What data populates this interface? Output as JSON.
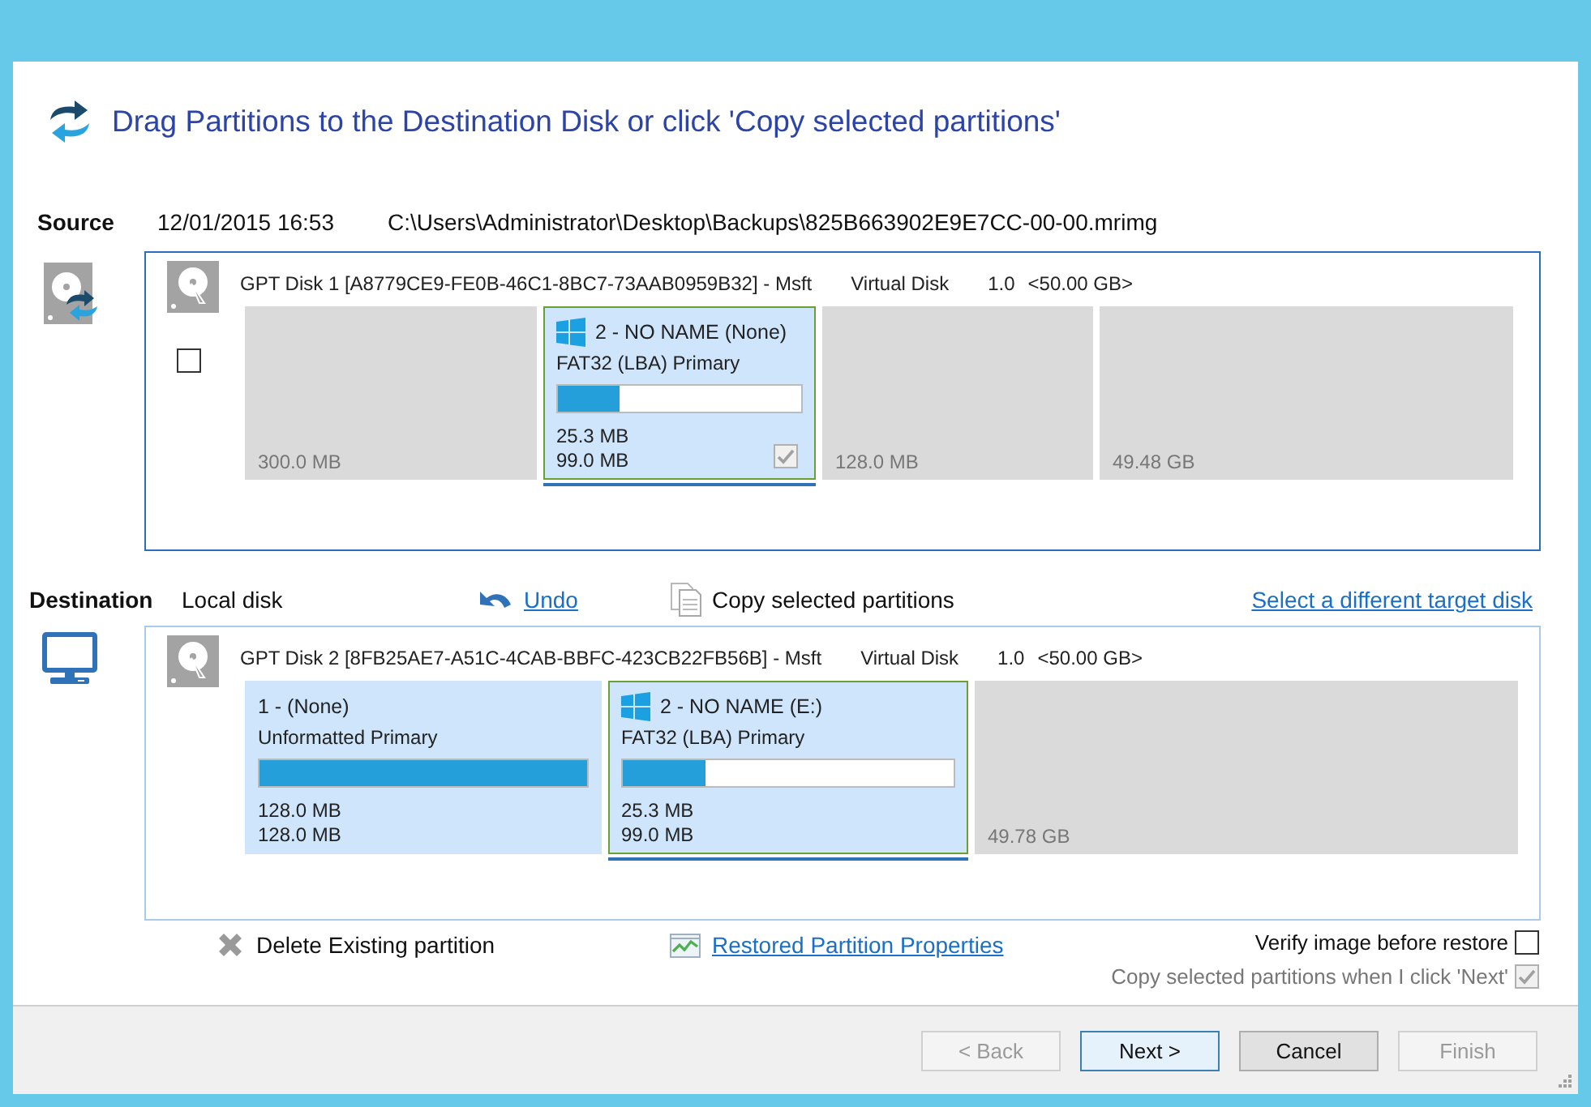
{
  "header": {
    "title": "Drag Partitions to the Destination Disk or click 'Copy selected partitions'"
  },
  "source": {
    "label": "Source",
    "date": "12/01/2015 16:53",
    "path": "C:\\Users\\Administrator\\Desktop\\Backups\\825B663902E9E7CC-00-00.mrimg",
    "disk": {
      "checked": false,
      "name": "GPT Disk 1 [A8779CE9-FE0B-46C1-8BC7-73AAB0959B32] - Msft",
      "type": "Virtual Disk",
      "version": "1.0",
      "size": "<50.00 GB>",
      "partitions": [
        {
          "kind": "empty",
          "total": "300.0 MB"
        },
        {
          "kind": "volume",
          "logo": true,
          "selected": true,
          "checked": true,
          "title": "2 - NO NAME (None)",
          "filesystem": "FAT32 (LBA) Primary",
          "level": 0.25,
          "used": "25.3 MB",
          "total": "99.0 MB"
        },
        {
          "kind": "empty",
          "total": "128.0 MB"
        },
        {
          "kind": "empty",
          "total": "49.48 GB"
        }
      ]
    }
  },
  "destination": {
    "label": "Destination",
    "target": "Local disk",
    "undo": "Undo",
    "copy": "Copy selected partitions",
    "select_link": "Select a different target disk",
    "disk": {
      "name": "GPT Disk 2 [8FB25AE7-A51C-4CAB-BBFC-423CB22FB56B] - Msft",
      "type": "Virtual Disk",
      "version": "1.0",
      "size": "<50.00 GB>",
      "partitions": [
        {
          "kind": "volume",
          "logo": false,
          "selected": false,
          "title": "1 -  (None)",
          "filesystem": "Unformatted Primary",
          "level": 1,
          "used": "128.0 MB",
          "total": "128.0 MB"
        },
        {
          "kind": "volume",
          "logo": true,
          "selected": true,
          "title": "2 - NO NAME (E:)",
          "filesystem": "FAT32 (LBA) Primary",
          "level": 0.25,
          "used": "25.3 MB",
          "total": "99.0 MB"
        },
        {
          "kind": "empty",
          "total": "49.78 GB"
        }
      ]
    }
  },
  "actions": {
    "delete": "Delete Existing partition",
    "properties": "Restored Partition Properties"
  },
  "options": [
    {
      "label": "Verify image before restore",
      "checked": false,
      "disabled": false
    },
    {
      "label": "Copy selected partitions when I click 'Next'",
      "checked": true,
      "disabled": true
    }
  ],
  "buttons": [
    {
      "label": "< Back",
      "disabled": true,
      "default": false
    },
    {
      "label": "Next >",
      "disabled": false,
      "default": true
    },
    {
      "label": "Cancel",
      "disabled": false,
      "default": false
    },
    {
      "label": "Finish",
      "disabled": true,
      "default": false
    }
  ]
}
